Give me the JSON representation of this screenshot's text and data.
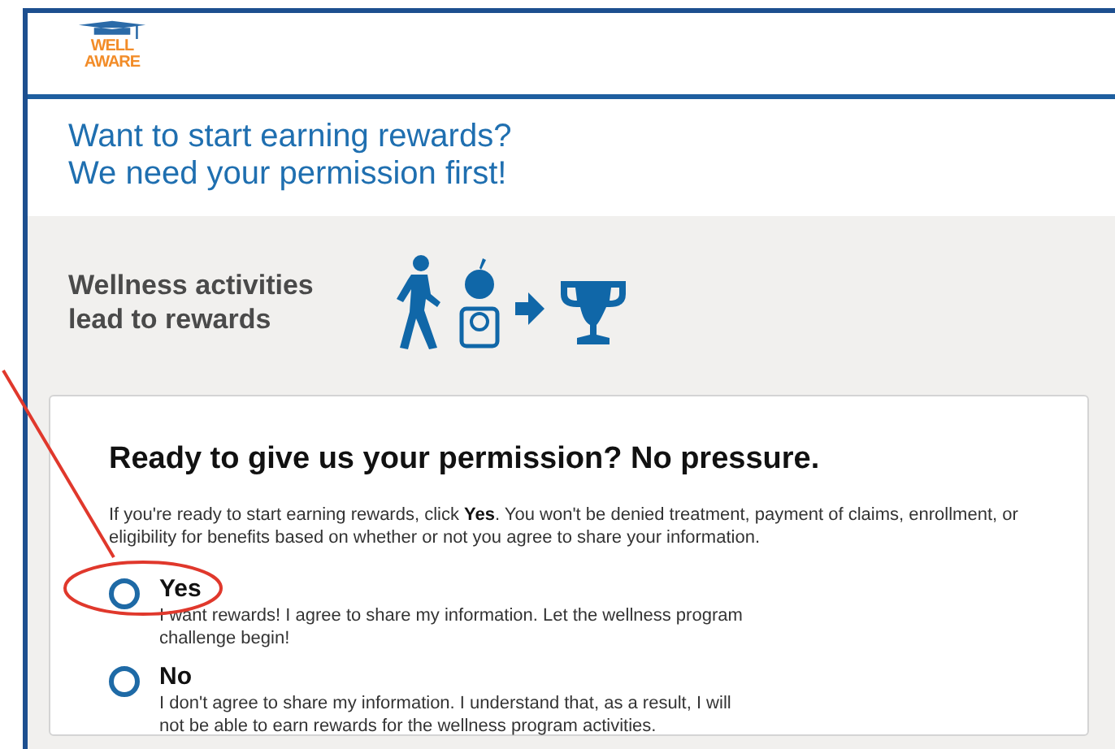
{
  "logo": {
    "line_1": "WELL",
    "line_2": "AWARE"
  },
  "headline": {
    "line_1": "Want to start earning rewards?",
    "line_2": "We need your permission first!"
  },
  "banner": {
    "text_line_1": "Wellness activities",
    "text_line_2": "lead to rewards"
  },
  "card": {
    "title": "Ready to give us your permission? No pressure.",
    "intro": "If you're ready to start earning rewards, click **Yes**. You won't be denied treatment, payment of claims, enrollment, or eligibility for benefits based on whether or not you agree to share your information.",
    "options": [
      {
        "label": "Yes",
        "description": "I want rewards! I agree to share my information. Let the wellness program challenge begin!",
        "selected": false
      },
      {
        "label": "No",
        "description": "I don't agree to share my information. I understand that, as a result, I will not be able to earn rewards for the wellness program activities.",
        "selected": false
      }
    ]
  }
}
